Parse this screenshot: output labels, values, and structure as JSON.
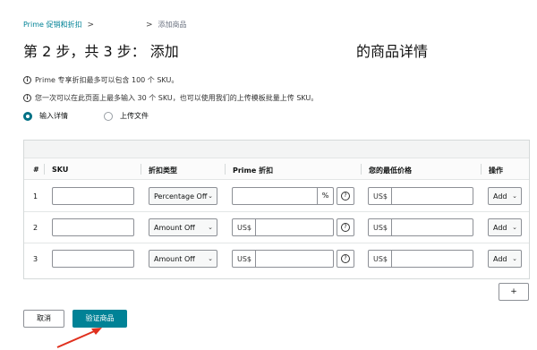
{
  "breadcrumb": {
    "root": "Prime 促销和折扣",
    "sep": ">",
    "current": "添加商品"
  },
  "title": {
    "left": "第 2 步，共 3 步： 添加",
    "right": "的商品详情"
  },
  "info": [
    "Prime 专享折扣最多可以包含 100 个 SKU。",
    "您一次可以在此页面上最多输入 30 个 SKU，也可以使用我们的上传模板批量上传 SKU。"
  ],
  "info_icon": "i",
  "radio": {
    "option1": "输入详情",
    "option2": "上传文件"
  },
  "table": {
    "headers": {
      "num": "#",
      "sku": "SKU",
      "type": "折扣类型",
      "prime": "Prime 折扣",
      "min_price": "您的最低价格",
      "action": "操作"
    },
    "rows": [
      {
        "num": "1",
        "type": "Percentage Off",
        "prime_prefix": "",
        "prime_suffix": "%",
        "currency": "US$",
        "action": "Add"
      },
      {
        "num": "2",
        "type": "Amount Off",
        "prime_prefix": "US$",
        "prime_suffix": "",
        "currency": "US$",
        "action": "Add"
      },
      {
        "num": "3",
        "type": "Amount Off",
        "prime_prefix": "US$",
        "prime_suffix": "",
        "currency": "US$",
        "action": "Add"
      }
    ]
  },
  "help_icon": "?",
  "chevron": "⌄",
  "plus_label": "+",
  "buttons": {
    "cancel": "取消",
    "verify": "验证商品"
  },
  "colors": {
    "accent": "#008296",
    "arrow": "#e0301e"
  }
}
